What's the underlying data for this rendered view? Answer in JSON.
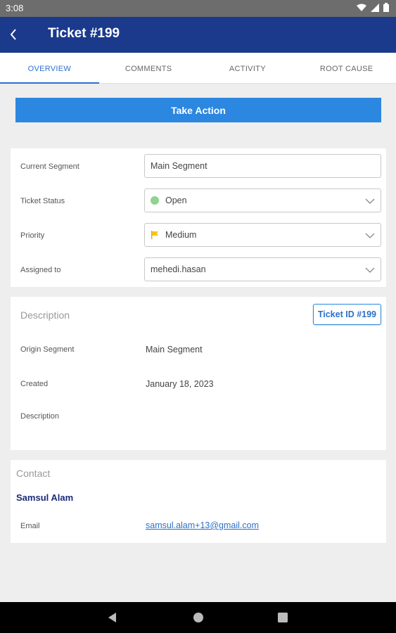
{
  "status_bar": {
    "time": "3:08"
  },
  "app_bar": {
    "title": "Ticket #199"
  },
  "tabs": [
    {
      "label": "OVERVIEW",
      "active": true
    },
    {
      "label": "COMMENTS",
      "active": false
    },
    {
      "label": "ACTIVITY",
      "active": false
    },
    {
      "label": "ROOT CAUSE",
      "active": false
    }
  ],
  "take_action": {
    "label": "Take Action"
  },
  "ticket_form": {
    "current_segment": {
      "label": "Current Segment",
      "value": "Main Segment"
    },
    "ticket_status": {
      "label": "Ticket Status",
      "value": "Open"
    },
    "priority": {
      "label": "Priority",
      "value": "Medium"
    },
    "assigned_to": {
      "label": "Assigned to",
      "value": "mehedi.hasan"
    }
  },
  "description_card": {
    "title": "Description",
    "ticket_id_button": "Ticket ID #199",
    "origin_segment": {
      "label": "Origin Segment",
      "value": "Main Segment"
    },
    "created": {
      "label": "Created",
      "value": "January 18, 2023"
    },
    "description": {
      "label": "Description",
      "value": ""
    }
  },
  "contact_card": {
    "title": "Contact",
    "name": "Samsul Alam",
    "email": {
      "label": "Email",
      "value": "samsul.alam+13@gmail.com"
    }
  },
  "colors": {
    "app_bar": "#1b3a8c",
    "accent": "#2b87e0",
    "status_open": "#8ed38e",
    "priority_medium": "#f5c518"
  }
}
